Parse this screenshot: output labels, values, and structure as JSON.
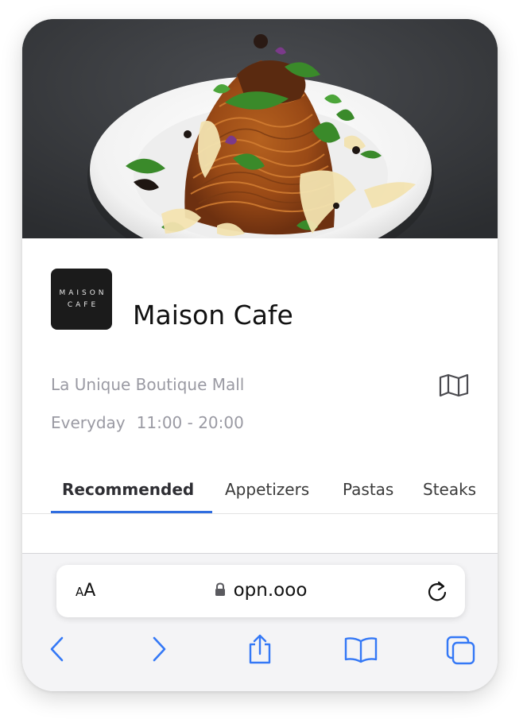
{
  "restaurant": {
    "logo_line1": "MAISON",
    "logo_line2": "CAFE",
    "name": "Maison Cafe",
    "location": "La Unique Boutique Mall",
    "days": "Everyday",
    "hours": "11:00 - 20:00"
  },
  "tabs": [
    {
      "label": "Recommended",
      "active": true
    },
    {
      "label": "Appetizers",
      "active": false
    },
    {
      "label": "Pastas",
      "active": false
    },
    {
      "label": "Steaks",
      "active": false
    }
  ],
  "browser": {
    "text_size_small": "A",
    "text_size_big": "A",
    "url": "opn.ooo"
  },
  "icons": [
    "map-icon",
    "lock-icon",
    "reload-icon",
    "back-icon",
    "forward-icon",
    "share-icon",
    "bookmarks-icon",
    "tabs-icon"
  ],
  "colors": {
    "accent": "#2f6de0",
    "ios_blue": "#3478f6",
    "muted_text": "#9a9aa3"
  }
}
